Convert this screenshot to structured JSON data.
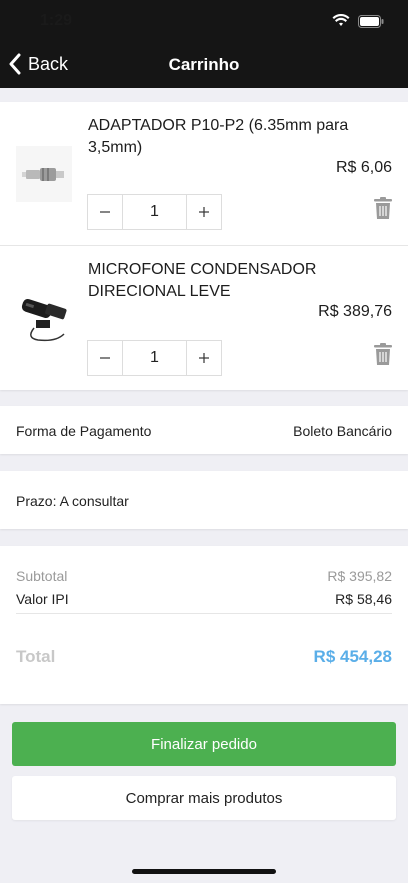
{
  "status": {
    "time": "1:29"
  },
  "nav": {
    "back_label": "Back",
    "title": "Carrinho"
  },
  "items": [
    {
      "name": "ADAPTADOR P10-P2 (6.35mm para 3,5mm)",
      "price": "R$ 6,06",
      "quantity": "1",
      "image_icon": "audio-adapter-image"
    },
    {
      "name": "MICROFONE CONDENSADOR DIRECIONAL LEVE",
      "price": "R$ 389,76",
      "quantity": "1",
      "image_icon": "microphone-image"
    }
  ],
  "payment": {
    "label": "Forma de Pagamento",
    "value": "Boleto Bancário"
  },
  "term": {
    "text": "Prazo: A consultar"
  },
  "summary": {
    "subtotal_label": "Subtotal",
    "subtotal_value": "R$ 395,82",
    "ipi_label": "Valor IPI",
    "ipi_value": "R$ 58,46",
    "total_label": "Total",
    "total_value": "R$ 454,28"
  },
  "actions": {
    "primary": "Finalizar pedido",
    "secondary": "Comprar mais produtos"
  },
  "colors": {
    "accent_green": "#4cb050",
    "total_blue": "#5aaee8",
    "nav_bg": "#151515"
  }
}
